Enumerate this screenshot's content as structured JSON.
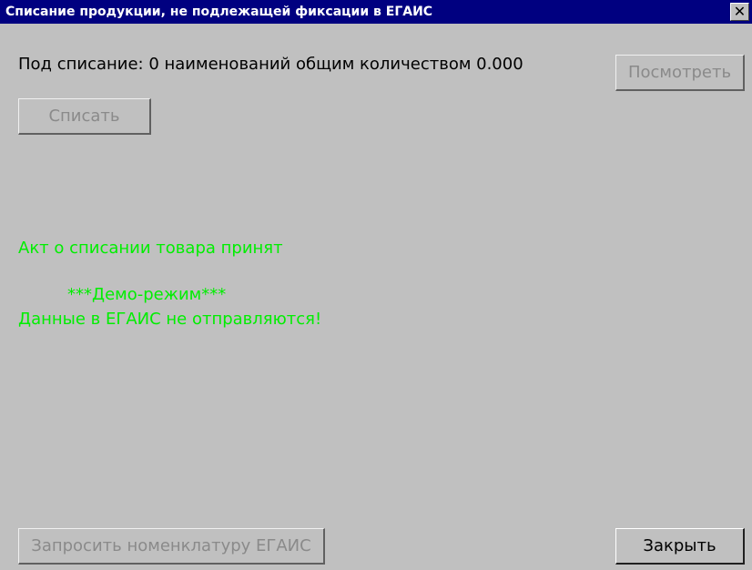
{
  "window": {
    "title": "Списание продукции, не подлежащей фиксации в ЕГАИС",
    "close_symbol": "✕"
  },
  "summary": {
    "text": "Под списание: 0 наименований общим количеством 0.000"
  },
  "buttons": {
    "view_label": "Посмотреть",
    "writeoff_label": "Списать",
    "request_label": "Запросить номенклатуру ЕГАИС",
    "close_label": "Закрыть"
  },
  "messages": {
    "accepted": "Акт о списании товара принят",
    "demo": "***Демо-режим***",
    "not_sent": "Данные в ЕГАИС не отправляются!"
  },
  "colors": {
    "titlebar": "#000080",
    "message": "#00ee00",
    "background": "#c0c0c0"
  }
}
